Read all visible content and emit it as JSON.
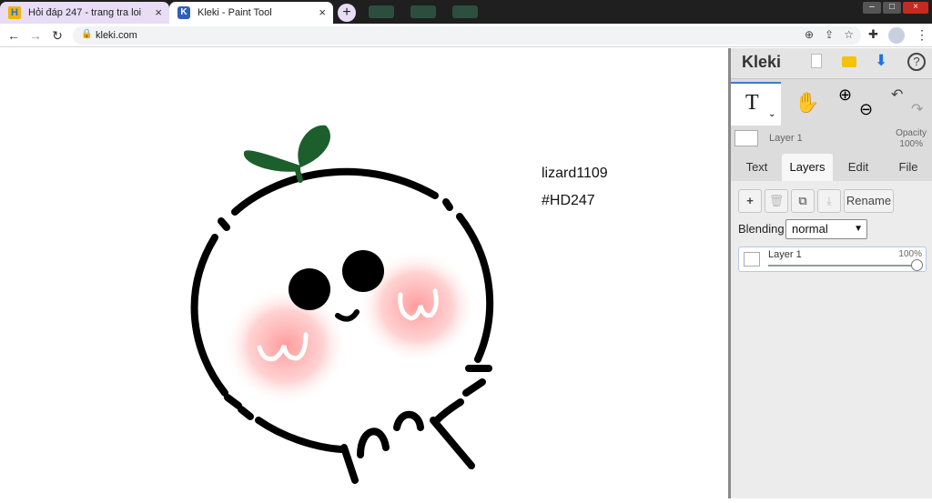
{
  "browser": {
    "tabs": [
      {
        "title": "Hỏi đáp 247 - trang tra loi",
        "favicon": "hoidap-favicon-icon",
        "color": "#e9dcf5"
      },
      {
        "title": "Kleki - Paint Tool",
        "favicon": "kleki-favicon-icon",
        "color": "#ffffff"
      }
    ],
    "new_tab": "+",
    "close_glyph": "×",
    "url": "kleki.com",
    "window_controls": [
      "–",
      "□",
      "×"
    ]
  },
  "canvas": {
    "texts": [
      "lizard1109",
      "#HD247"
    ],
    "colors": {
      "leaf": "#1d5e2d",
      "line": "#000000",
      "blush": "#ff8a8a"
    }
  },
  "panel": {
    "logo": "Kleki",
    "tools": [
      "T",
      "✋",
      "⊕",
      "⊖"
    ],
    "layer_name": "Layer 1",
    "opacity_label": "Opacity",
    "opacity_value": "100%",
    "tabs": [
      "Text",
      "Layers",
      "Edit",
      "File"
    ],
    "active_tab": "Layers",
    "buttons": {
      "add": "+",
      "delete": "🗑",
      "duplicate": "⧉",
      "merge": "⤓",
      "rename": "Rename"
    },
    "blending_label": "Blending",
    "blending_value": "normal",
    "layer_item": {
      "name": "Layer 1",
      "opacity": "100%"
    },
    "accent": "#3a7bd5"
  }
}
